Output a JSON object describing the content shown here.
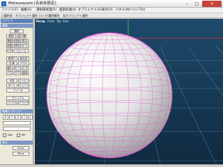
{
  "window": {
    "title": "Metasequoia [名前未設定]",
    "minimize_glyph": "–",
    "maximize_glyph": "□",
    "close_glyph": "×"
  },
  "menubar": {
    "items": [
      "ファイル(F)",
      "編集(E)",
      "選択部処理(A)",
      "面部処理(S)",
      "オブジェクト(O)",
      "表示(V)",
      "パネル(W)",
      "ヘルプ(H)"
    ]
  },
  "toolbar": {
    "items": [
      "□選択部",
      "オブジェクト選択",
      "ロック/選択解除",
      "全オブジェクト選択"
    ]
  },
  "command_panel": {
    "header": "コマンド",
    "section_edit": "編集",
    "buttons": [
      "選択",
      "範囲",
      "投げ縄",
      "移動",
      "回転",
      "拡大",
      "回転",
      "押出",
      "ナイフ",
      "LOD",
      "スムース",
      "面張り",
      "面生成",
      "辺/面",
      "ベベル",
      "縮小",
      "モーフ",
      "ミラー",
      "パス",
      "ラティス",
      "裏返",
      "作成",
      "マッピング",
      "ボーン",
      "ウェイト",
      "フリーズ",
      "マテリアル",
      "ハンドル",
      "ドラッグ"
    ],
    "section_view": "編集オプション",
    "mini_buttons": [
      "X",
      "Y",
      "Z",
      "C",
      "L"
    ],
    "checks": [
      "Dev",
      "Mir"
    ],
    "section_mode": "表示",
    "mode_buttons": [
      "Zoom",
      "Move"
    ]
  },
  "viewport": {
    "tabs": [
      "Persp",
      "Front",
      "Top",
      "Side"
    ],
    "active_tab": "Persp",
    "colors": {
      "background_top": "#1f4a6b",
      "background_bottom": "#0f2a40",
      "grid": "#7fa3c2",
      "wire": "#e24fd1",
      "axis_x": "#d03535",
      "axis_y": "#2fbf4a",
      "axis_z": "#3a7bd5"
    }
  }
}
